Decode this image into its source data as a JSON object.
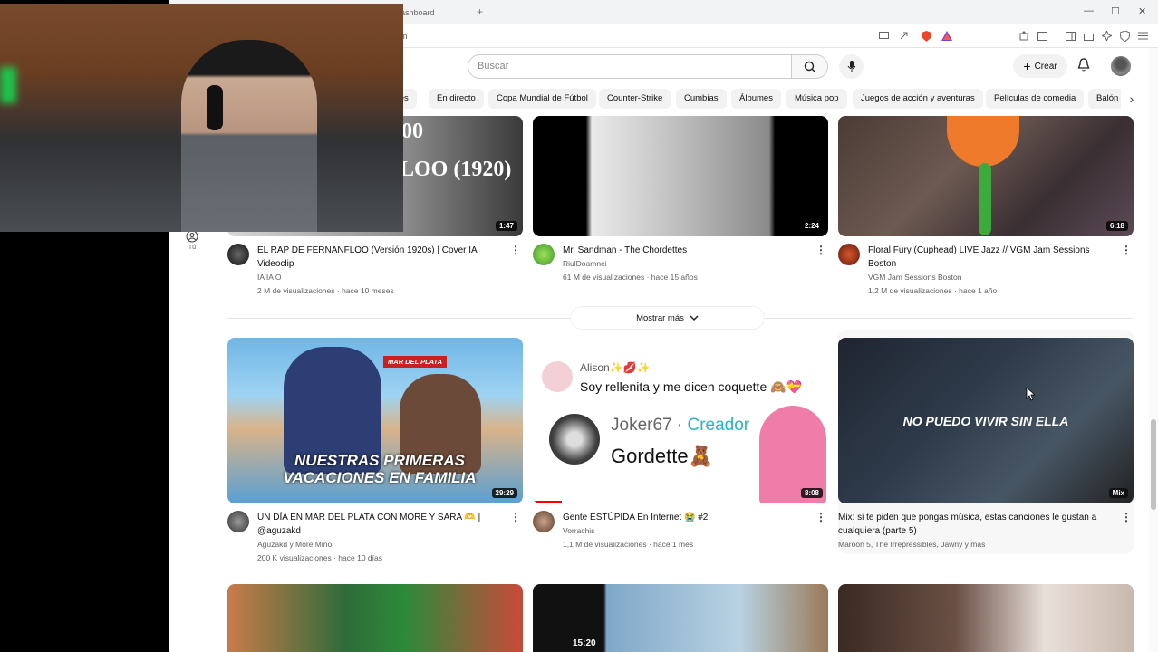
{
  "browser": {
    "tab_title": "ashboard",
    "new_tab": "+",
    "url": "m",
    "win_min": "—",
    "win_max": "☐",
    "win_close": "✕"
  },
  "header": {
    "search_placeholder": "Buscar",
    "create_label": "Crear"
  },
  "chips": [
    "Mixes",
    "En directo",
    "Copa Mundial de Fútbol",
    "Counter-Strike",
    "Cumbias",
    "Álbumes",
    "Música pop",
    "Juegos de acción y aventuras",
    "Películas de comedia",
    "Balón d"
  ],
  "sidebar": {
    "you_label": "Tú"
  },
  "show_more": "Mostrar más",
  "videos_row1": [
    {
      "title": "EL RAP DE FERNANFLOO (Versión 1920s) | Cover IA Videoclip",
      "channel": "IA IA O",
      "stats": "2 M de visualizaciones · hace 10 meses",
      "duration": "1:47",
      "thumb_text": "LOO (1920)",
      "thumb_text2": "00"
    },
    {
      "title": "Mr. Sandman - The Chordettes",
      "channel": "RiulDoamnei",
      "stats": "61 M de visualizaciones · hace 15 años",
      "duration": "2:24"
    },
    {
      "title": "Floral Fury (Cuphead) LIVE Jazz // VGM Jam Sessions Boston",
      "channel": "VGM Jam Sessions Boston",
      "stats": "1,2 M de visualizaciones · hace 1 año",
      "duration": "6:18"
    }
  ],
  "videos_row2": [
    {
      "title": "UN DÍA EN MAR DEL PLATA CON MORE Y SARA 🫶 | @aguzakd",
      "channel": "Aguzakd y More Miño",
      "stats": "200 K visualizaciones · hace 10 días",
      "duration": "29:29",
      "thumb_text": "NUESTRAS PRIMERAS VACACIONES EN FAMILIA",
      "thumb_badge": "MAR DEL PLATA"
    },
    {
      "title": "Gente ESTÚPIDA En Internet 😭 #2",
      "channel": "Vorrachis",
      "stats": "1,1 M de visualizaciones · hace 1 mes",
      "duration": "8:08",
      "thumb_line1": "Alison✨💋✨",
      "thumb_line2": "Soy rellenita y me dicen coquette 🙈💝",
      "thumb_line3a": "Joker67 · ",
      "thumb_line3b": "Creador",
      "thumb_line4": "Gordette🧸"
    },
    {
      "title": "Mix: si te piden que pongas música, estas canciones le gustan a cualquiera (parte 5)",
      "channel": "Maroon 5, The Irrepressibles, Jawny y más",
      "stats": "",
      "duration": "Mix",
      "thumb_text": "NO PUEDO VIVIR SIN ELLA"
    }
  ],
  "videos_row3": [
    {
      "duration": ""
    },
    {
      "timer": "15:20"
    },
    {
      "duration": ""
    }
  ],
  "colors": {
    "chip_bg": "#f2f2f2",
    "creator_teal": "#27b5c6",
    "badge_red": "#cc1f1f"
  }
}
